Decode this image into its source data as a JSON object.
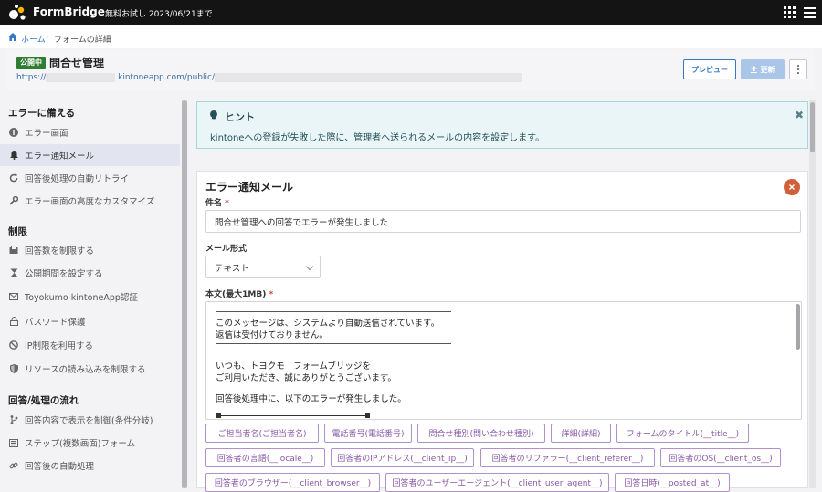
{
  "app": {
    "brand": "FormBridge",
    "trial_notice": "無料お試し 2023/06/21まで"
  },
  "breadcrumb": {
    "home": "ホーム",
    "separator": "›",
    "current": "フォームの詳細"
  },
  "header": {
    "status": "公開中",
    "title": "問合せ管理",
    "url_prefix": "https://",
    "url_domain": ".kintoneapp.com/public/",
    "preview_label": "プレビュー",
    "update_label": "更新"
  },
  "sidebar": {
    "sections": [
      {
        "title": "エラーに備える",
        "items": [
          {
            "label": "エラー画面",
            "icon": "info-icon"
          },
          {
            "label": "エラー通知メール",
            "icon": "bell-icon",
            "active": true
          },
          {
            "label": "回答後処理の自動リトライ",
            "icon": "refresh-icon"
          },
          {
            "label": "エラー画面の高度なカスタマイズ",
            "icon": "wrench-icon"
          }
        ]
      },
      {
        "title": "制限",
        "items": [
          {
            "label": "回答数を制限する",
            "icon": "inbox-icon"
          },
          {
            "label": "公開期間を設定する",
            "icon": "hourglass-icon"
          },
          {
            "label": "Toyokumo kintoneApp認証",
            "icon": "mail-icon"
          },
          {
            "label": "パスワード保護",
            "icon": "lock-icon"
          },
          {
            "label": "IP制限を利用する",
            "icon": "ban-icon"
          },
          {
            "label": "リソースの読み込みを制限する",
            "icon": "shield-icon"
          }
        ]
      },
      {
        "title": "回答/処理の流れ",
        "items": [
          {
            "label": "回答内容で表示を制御(条件分岐)",
            "icon": "branch-icon"
          },
          {
            "label": "ステップ(複数画面)フォーム",
            "icon": "steps-icon"
          },
          {
            "label": "回答後の自動処理",
            "icon": "link-icon"
          }
        ]
      }
    ]
  },
  "hint": {
    "title": "ヒント",
    "text": "kintoneへの登録が失敗した際に、管理者へ送られるメールの内容を設定します。",
    "close": "✖"
  },
  "card": {
    "title": "エラー通知メール",
    "subject_label": "件名",
    "subject_value": "問合せ管理への回答でエラーが発生しました",
    "format_label": "メール形式",
    "format_value": "テキスト",
    "body_label": "本文(最大1MB)",
    "required_mark": "*",
    "body_lines": [
      "このメッセージは、システムより自動送信されています。",
      "返信は受付けておりません。",
      "いつも、トヨクモ　フォームブリッジを",
      "ご利用いただき、誠にありがとうございます。",
      "回答後処理中に、以下のエラーが発生しました。"
    ]
  },
  "tags": [
    "ご担当者名(ご担当者名)",
    "電話番号(電話番号)",
    "問合せ種別(問い合わせ種別)",
    "詳細(詳細)",
    "フォームのタイトル(__title__)",
    "回答者の言語(__locale__)",
    "回答者のIPアドレス(__client_ip__)",
    "回答者のリファラー(__client_referer__)",
    "回答者のOS(__client_os__)",
    "回答者のブラウザー(__client_browser__)",
    "回答者のユーザーエージェント(__client_user_agent__)",
    "回答日時(__posted_at__)"
  ],
  "colors": {
    "accent": "#3478c6",
    "status_green": "#2e7d32",
    "tag_purple": "#8a57a8",
    "delete_orange": "#d0603a"
  }
}
